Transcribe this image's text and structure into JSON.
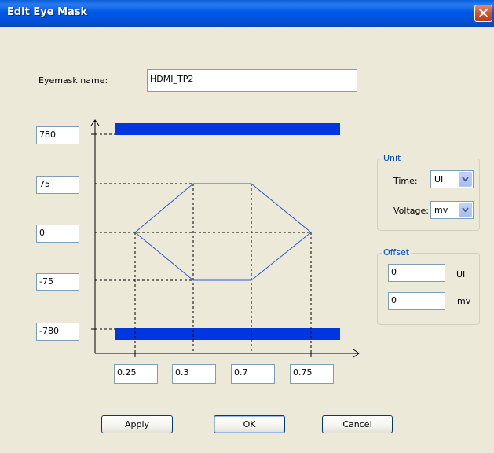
{
  "window": {
    "title": "Edit Eye Mask",
    "close_icon": "close-icon"
  },
  "eyemask": {
    "name_label": "Eyemask name:",
    "name_value": "HDMI_TP2"
  },
  "y_fields": [
    "780",
    "75",
    "0",
    "-75",
    "-780"
  ],
  "x_fields": [
    "0.25",
    "0.3",
    "0.7",
    "0.75"
  ],
  "unit": {
    "title": "Unit",
    "time_label": "Time:",
    "time_value": "UI",
    "voltage_label": "Voltage:",
    "voltage_value": "mv"
  },
  "offset": {
    "title": "Offset",
    "time_value": "0",
    "time_unit": "UI",
    "voltage_value": "0",
    "voltage_unit": "mv"
  },
  "buttons": {
    "apply": "Apply",
    "ok": "OK",
    "cancel": "Cancel"
  },
  "colors": {
    "mask_fill": "#0036e0",
    "hexagon_line": "#2a58d8",
    "title_bar": "#0054e3",
    "group_title": "#0046d5"
  }
}
